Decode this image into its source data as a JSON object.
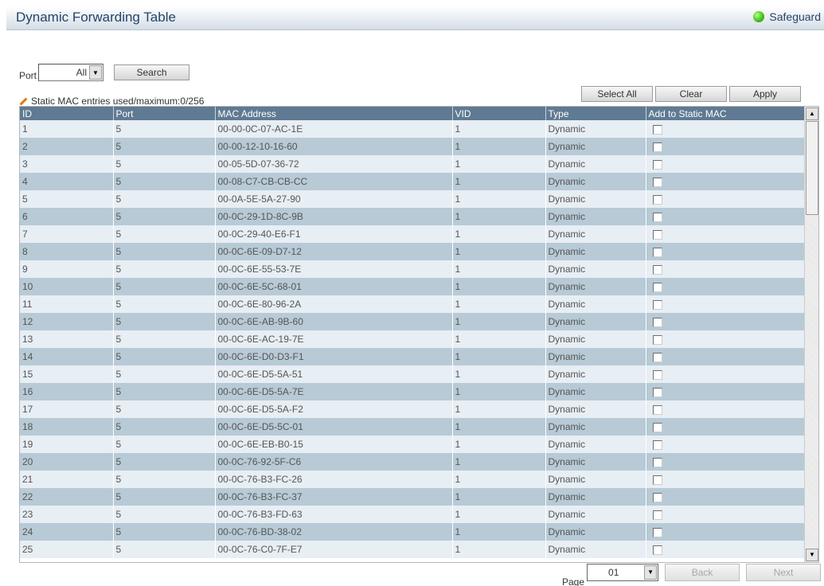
{
  "header": {
    "title": "Dynamic Forwarding Table",
    "status_label": "Safeguard",
    "status_color": "#46c21c"
  },
  "filter": {
    "port_label": "Port",
    "port_value": "All",
    "search_label": "Search"
  },
  "actions": {
    "select_all_label": "Select All",
    "clear_label": "Clear",
    "apply_label": "Apply"
  },
  "entries_text": "Static MAC entries used/maximum:0/256",
  "table": {
    "columns": [
      "ID",
      "Port",
      "MAC Address",
      "VID",
      "Type",
      "Add to Static MAC"
    ],
    "rows": [
      {
        "id": "1",
        "port": "5",
        "mac": "00-00-0C-07-AC-1E",
        "vid": "1",
        "type": "Dynamic"
      },
      {
        "id": "2",
        "port": "5",
        "mac": "00-00-12-10-16-60",
        "vid": "1",
        "type": "Dynamic"
      },
      {
        "id": "3",
        "port": "5",
        "mac": "00-05-5D-07-36-72",
        "vid": "1",
        "type": "Dynamic"
      },
      {
        "id": "4",
        "port": "5",
        "mac": "00-08-C7-CB-CB-CC",
        "vid": "1",
        "type": "Dynamic"
      },
      {
        "id": "5",
        "port": "5",
        "mac": "00-0A-5E-5A-27-90",
        "vid": "1",
        "type": "Dynamic"
      },
      {
        "id": "6",
        "port": "5",
        "mac": "00-0C-29-1D-8C-9B",
        "vid": "1",
        "type": "Dynamic"
      },
      {
        "id": "7",
        "port": "5",
        "mac": "00-0C-29-40-E6-F1",
        "vid": "1",
        "type": "Dynamic"
      },
      {
        "id": "8",
        "port": "5",
        "mac": "00-0C-6E-09-D7-12",
        "vid": "1",
        "type": "Dynamic"
      },
      {
        "id": "9",
        "port": "5",
        "mac": "00-0C-6E-55-53-7E",
        "vid": "1",
        "type": "Dynamic"
      },
      {
        "id": "10",
        "port": "5",
        "mac": "00-0C-6E-5C-68-01",
        "vid": "1",
        "type": "Dynamic"
      },
      {
        "id": "11",
        "port": "5",
        "mac": "00-0C-6E-80-96-2A",
        "vid": "1",
        "type": "Dynamic"
      },
      {
        "id": "12",
        "port": "5",
        "mac": "00-0C-6E-AB-9B-60",
        "vid": "1",
        "type": "Dynamic"
      },
      {
        "id": "13",
        "port": "5",
        "mac": "00-0C-6E-AC-19-7E",
        "vid": "1",
        "type": "Dynamic"
      },
      {
        "id": "14",
        "port": "5",
        "mac": "00-0C-6E-D0-D3-F1",
        "vid": "1",
        "type": "Dynamic"
      },
      {
        "id": "15",
        "port": "5",
        "mac": "00-0C-6E-D5-5A-51",
        "vid": "1",
        "type": "Dynamic"
      },
      {
        "id": "16",
        "port": "5",
        "mac": "00-0C-6E-D5-5A-7E",
        "vid": "1",
        "type": "Dynamic"
      },
      {
        "id": "17",
        "port": "5",
        "mac": "00-0C-6E-D5-5A-F2",
        "vid": "1",
        "type": "Dynamic"
      },
      {
        "id": "18",
        "port": "5",
        "mac": "00-0C-6E-D5-5C-01",
        "vid": "1",
        "type": "Dynamic"
      },
      {
        "id": "19",
        "port": "5",
        "mac": "00-0C-6E-EB-B0-15",
        "vid": "1",
        "type": "Dynamic"
      },
      {
        "id": "20",
        "port": "5",
        "mac": "00-0C-76-92-5F-C6",
        "vid": "1",
        "type": "Dynamic"
      },
      {
        "id": "21",
        "port": "5",
        "mac": "00-0C-76-B3-FC-26",
        "vid": "1",
        "type": "Dynamic"
      },
      {
        "id": "22",
        "port": "5",
        "mac": "00-0C-76-B3-FC-37",
        "vid": "1",
        "type": "Dynamic"
      },
      {
        "id": "23",
        "port": "5",
        "mac": "00-0C-76-B3-FD-63",
        "vid": "1",
        "type": "Dynamic"
      },
      {
        "id": "24",
        "port": "5",
        "mac": "00-0C-76-BD-38-02",
        "vid": "1",
        "type": "Dynamic"
      },
      {
        "id": "25",
        "port": "5",
        "mac": "00-0C-76-C0-7F-E7",
        "vid": "1",
        "type": "Dynamic"
      }
    ]
  },
  "pagination": {
    "page_label": "Page",
    "page_value": "01",
    "back_label": "Back",
    "next_label": "Next"
  }
}
